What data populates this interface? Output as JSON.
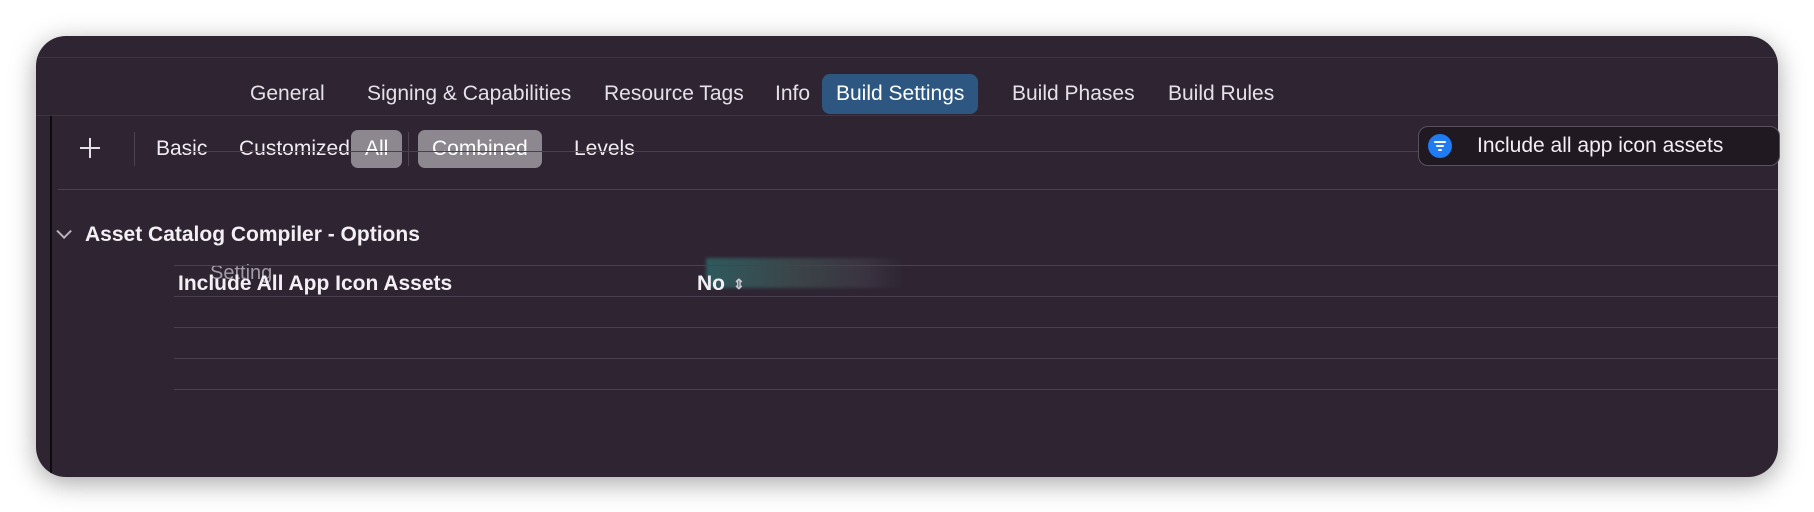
{
  "tabs": [
    {
      "label": "General"
    },
    {
      "label": "Signing & Capabilities"
    },
    {
      "label": "Resource Tags"
    },
    {
      "label": "Info"
    },
    {
      "label": "Build Settings",
      "selected": true
    },
    {
      "label": "Build Phases"
    },
    {
      "label": "Build Rules"
    }
  ],
  "toolbar": {
    "add_icon": "plus-icon",
    "scope": {
      "basic": "Basic",
      "customized": "Customized",
      "all": "All",
      "selected": "All"
    },
    "view": {
      "combined": "Combined",
      "levels": "Levels",
      "selected": "Combined"
    }
  },
  "filter": {
    "icon": "filter-icon",
    "value": "Include all app icon assets",
    "accent": "#1f7cf2"
  },
  "section": {
    "title": "Asset Catalog Compiler - Options",
    "expanded": true
  },
  "table": {
    "column_setting": "Setting",
    "rows": [
      {
        "name": "Include All App Icon Assets",
        "value": "No",
        "control": "popup-stepper-icon"
      }
    ]
  },
  "colors": {
    "window_bg": "#2e2432",
    "selected_tab": "#2d5781",
    "selected_segment": "#8d8890"
  }
}
